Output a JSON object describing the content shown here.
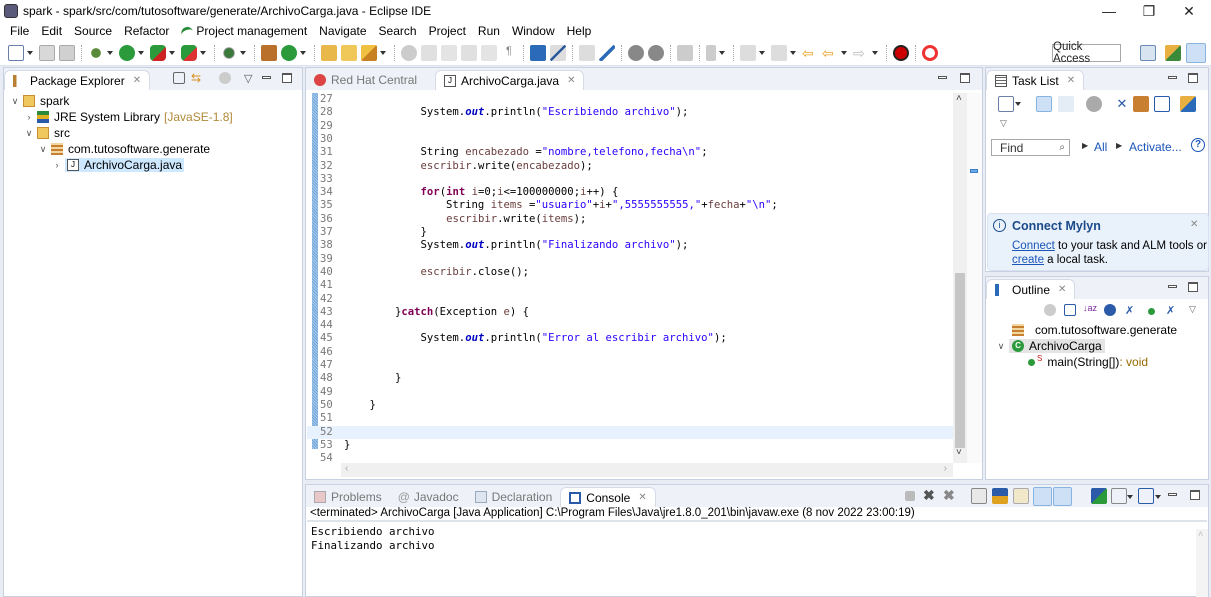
{
  "window": {
    "title": "spark - spark/src/com/tutosoftware/generate/ArchivoCarga.java - Eclipse IDE",
    "controls": {
      "minimize": "—",
      "restore": "❐",
      "close": "✕"
    }
  },
  "menu": [
    "File",
    "Edit",
    "Source",
    "Refactor",
    "Project management",
    "Navigate",
    "Search",
    "Project",
    "Run",
    "Window",
    "Help"
  ],
  "toolbar": {
    "quick_access": "Quick Access",
    "icons": [
      "new-icon",
      "save-icon",
      "save-all-icon",
      "debug-icon",
      "run-icon",
      "coverage-icon",
      "external-tools-icon",
      "search-icon",
      "new-package-icon",
      "new-class-icon",
      "open-type-icon",
      "open-task-icon",
      "open-resource-icon",
      "tips-icon",
      "toggle-mark-occurrences-icon",
      "block-selection-icon",
      "show-whitespace-icon",
      "open-console-icon",
      "next-annotation-icon",
      "previous-annotation-icon",
      "last-edit-icon",
      "back-icon",
      "forward-icon",
      "redhat-icon",
      "sync-icon",
      "open-perspective-icon",
      "java-ee-icon",
      "java-perspective-icon"
    ]
  },
  "package_explorer": {
    "tab_label": "Package Explorer",
    "tree": [
      {
        "label": "spark",
        "expanded": true,
        "icon": "project-icon"
      },
      {
        "label": "JRE System Library",
        "decoration": "[JavaSE-1.8]",
        "expanded": false,
        "icon": "library-icon"
      },
      {
        "label": "src",
        "expanded": true,
        "icon": "source-folder-icon"
      },
      {
        "label": "com.tutosoftware.generate",
        "expanded": true,
        "icon": "package-icon"
      },
      {
        "label": "ArchivoCarga.java",
        "expanded": false,
        "selected": true,
        "icon": "java-file-icon"
      }
    ]
  },
  "editor": {
    "tabs": [
      {
        "label": "Red Hat Central",
        "active": false
      },
      {
        "label": "ArchivoCarga.java",
        "active": true
      }
    ],
    "current_line": 52,
    "lines": [
      {
        "n": "27",
        "tokens": []
      },
      {
        "n": "28",
        "tokens": [
          [
            "",
            "            System."
          ],
          [
            "fld",
            "out"
          ],
          [
            "",
            ".println("
          ],
          [
            "str",
            "\"Escribiendo archivo\""
          ],
          [
            "",
            ");"
          ]
        ]
      },
      {
        "n": "29",
        "tokens": []
      },
      {
        "n": "30",
        "tokens": []
      },
      {
        "n": "31",
        "tokens": [
          [
            "",
            "            String "
          ],
          [
            "var",
            "encabezado"
          ],
          [
            "",
            " ="
          ],
          [
            "str",
            "\"nombre,telefono,fecha\\n\""
          ],
          [
            "",
            ";"
          ]
        ]
      },
      {
        "n": "32",
        "tokens": [
          [
            "",
            "            "
          ],
          [
            "var",
            "escribir"
          ],
          [
            "",
            ".write("
          ],
          [
            "var",
            "encabezado"
          ],
          [
            "",
            ");"
          ]
        ]
      },
      {
        "n": "33",
        "tokens": []
      },
      {
        "n": "34",
        "tokens": [
          [
            "",
            "            "
          ],
          [
            "kw",
            "for"
          ],
          [
            "",
            "("
          ],
          [
            "kw",
            "int"
          ],
          [
            "",
            " "
          ],
          [
            "var",
            "i"
          ],
          [
            "",
            "=0;"
          ],
          [
            "var",
            "i"
          ],
          [
            "",
            "<=100000000;"
          ],
          [
            "var",
            "i"
          ],
          [
            "",
            "++) {"
          ]
        ]
      },
      {
        "n": "35",
        "tokens": [
          [
            "",
            "                String "
          ],
          [
            "var",
            "items"
          ],
          [
            "",
            " ="
          ],
          [
            "str",
            "\"usuario\""
          ],
          [
            "",
            "+"
          ],
          [
            "var",
            "i"
          ],
          [
            "",
            "+"
          ],
          [
            "str",
            "\",5555555555,\""
          ],
          [
            "",
            "+"
          ],
          [
            "var",
            "fecha"
          ],
          [
            "",
            "+"
          ],
          [
            "str",
            "\"\\n\""
          ],
          [
            "",
            ";"
          ]
        ]
      },
      {
        "n": "36",
        "tokens": [
          [
            "",
            "                "
          ],
          [
            "var",
            "escribir"
          ],
          [
            "",
            ".write("
          ],
          [
            "var",
            "items"
          ],
          [
            "",
            ");"
          ]
        ]
      },
      {
        "n": "37",
        "tokens": [
          [
            "",
            "            }"
          ]
        ]
      },
      {
        "n": "38",
        "tokens": [
          [
            "",
            "            System."
          ],
          [
            "fld",
            "out"
          ],
          [
            "",
            ".println("
          ],
          [
            "str",
            "\"Finalizando archivo\""
          ],
          [
            "",
            ");"
          ]
        ]
      },
      {
        "n": "39",
        "tokens": []
      },
      {
        "n": "40",
        "tokens": [
          [
            "",
            "            "
          ],
          [
            "var",
            "escribir"
          ],
          [
            "",
            ".close();"
          ]
        ]
      },
      {
        "n": "41",
        "tokens": []
      },
      {
        "n": "42",
        "tokens": []
      },
      {
        "n": "43",
        "tokens": [
          [
            "",
            "        }"
          ],
          [
            "kw",
            "catch"
          ],
          [
            "",
            "(Exception "
          ],
          [
            "var",
            "e"
          ],
          [
            "",
            ") {"
          ]
        ]
      },
      {
        "n": "44",
        "tokens": []
      },
      {
        "n": "45",
        "tokens": [
          [
            "",
            "            System."
          ],
          [
            "fld",
            "out"
          ],
          [
            "",
            ".println("
          ],
          [
            "str",
            "\"Error al escribir archivo\""
          ],
          [
            "",
            ");"
          ]
        ]
      },
      {
        "n": "46",
        "tokens": []
      },
      {
        "n": "47",
        "tokens": []
      },
      {
        "n": "48",
        "tokens": [
          [
            "",
            "        }"
          ]
        ]
      },
      {
        "n": "49",
        "tokens": []
      },
      {
        "n": "50",
        "tokens": [
          [
            "",
            "    }"
          ]
        ]
      },
      {
        "n": "51",
        "tokens": []
      },
      {
        "n": "52",
        "tokens": []
      },
      {
        "n": "53",
        "tokens": [
          [
            "",
            "}"
          ]
        ]
      },
      {
        "n": "54",
        "tokens": []
      }
    ]
  },
  "task_list": {
    "tab_label": "Task List",
    "find_placeholder": "Find",
    "all_label": "All",
    "activate_label": "Activate...",
    "help": "?"
  },
  "mylyn": {
    "title": "Connect Mylyn",
    "connect_link": "Connect",
    "text1": " to your task and ALM tools or",
    "create_link": "create",
    "text2": " a local task."
  },
  "outline": {
    "tab_label": "Outline",
    "items": [
      {
        "label": "com.tutosoftware.generate",
        "icon": "package-icon"
      },
      {
        "label": "ArchivoCarga",
        "icon": "class-icon",
        "expanded": true
      },
      {
        "label": "main(String[])",
        "suffix": " : void",
        "icon": "method-icon",
        "modifier": "S"
      }
    ]
  },
  "bottom": {
    "tabs": [
      {
        "label": "Problems",
        "active": false
      },
      {
        "label": "Javadoc",
        "active": false
      },
      {
        "label": "Declaration",
        "active": false
      },
      {
        "label": "Console",
        "active": true
      }
    ],
    "console_header": "<terminated> ArchivoCarga [Java Application] C:\\Program Files\\Java\\jre1.8.0_201\\bin\\javaw.exe (8 nov 2022 23:00:19)",
    "console_output": [
      "Escribiendo archivo",
      "Finalizando archivo"
    ]
  },
  "colors": {
    "keyword": "#7f0055",
    "string": "#2a00ff",
    "field": "#0000c0",
    "selection": "#cde8ff",
    "current_line": "#e8f2fe"
  }
}
